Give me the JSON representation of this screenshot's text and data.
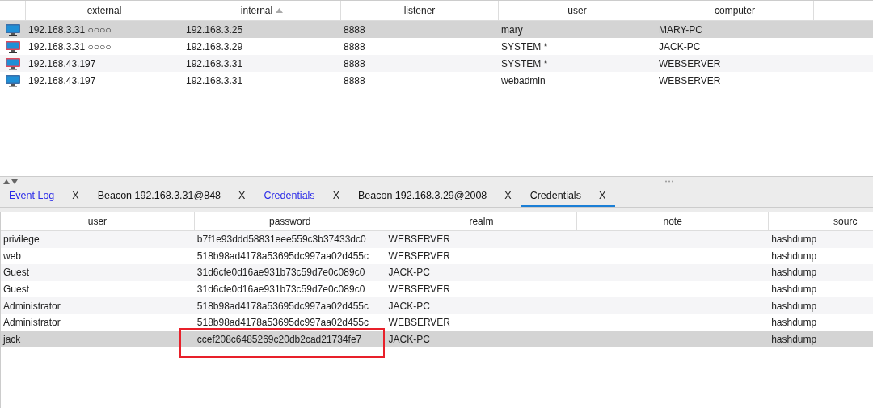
{
  "sessions": {
    "columns": [
      {
        "label": "external",
        "sorted": false
      },
      {
        "label": "internal",
        "sorted": true
      },
      {
        "label": "listener",
        "sorted": false
      },
      {
        "label": "user",
        "sorted": false
      },
      {
        "label": "computer",
        "sorted": false
      }
    ],
    "rows": [
      {
        "kind": "normal",
        "selected": true,
        "cells": [
          "192.168.3.31 ○○○○",
          "192.168.3.25",
          "8888",
          "mary",
          "MARY-PC"
        ]
      },
      {
        "kind": "elevated",
        "selected": false,
        "cells": [
          "192.168.3.31 ○○○○",
          "192.168.3.29",
          "8888",
          "SYSTEM *",
          "JACK-PC"
        ]
      },
      {
        "kind": "elevated",
        "selected": false,
        "cells": [
          "192.168.43.197",
          "192.168.3.31",
          "8888",
          "SYSTEM *",
          "WEBSERVER"
        ]
      },
      {
        "kind": "normal",
        "selected": false,
        "cells": [
          "192.168.43.197",
          "192.168.3.31",
          "8888",
          "webadmin",
          "WEBSERVER"
        ]
      }
    ]
  },
  "tabs": [
    {
      "label": "Event Log",
      "close": "X",
      "highlighted": true,
      "selected": false
    },
    {
      "label": "Beacon 192.168.3.31@848",
      "close": "X",
      "highlighted": false,
      "selected": false
    },
    {
      "label": "Credentials",
      "close": "X",
      "highlighted": true,
      "selected": false
    },
    {
      "label": "Beacon 192.168.3.29@2008",
      "close": "X",
      "highlighted": false,
      "selected": false
    },
    {
      "label": "Credentials",
      "close": "X",
      "highlighted": false,
      "selected": true
    }
  ],
  "credentials": {
    "columns": [
      "user",
      "password",
      "realm",
      "note",
      "sourc"
    ],
    "rows": [
      {
        "selected": false,
        "boxed": false,
        "cells": [
          "privilege",
          "b7f1e93ddd58831eee559c3b37433dc0",
          "WEBSERVER",
          "",
          "hashdump"
        ]
      },
      {
        "selected": false,
        "boxed": false,
        "cells": [
          "web",
          "518b98ad4178a53695dc997aa02d455c",
          "WEBSERVER",
          "",
          "hashdump"
        ]
      },
      {
        "selected": false,
        "boxed": false,
        "cells": [
          "Guest",
          "31d6cfe0d16ae931b73c59d7e0c089c0",
          "JACK-PC",
          "",
          "hashdump"
        ]
      },
      {
        "selected": false,
        "boxed": false,
        "cells": [
          "Guest",
          "31d6cfe0d16ae931b73c59d7e0c089c0",
          "WEBSERVER",
          "",
          "hashdump"
        ]
      },
      {
        "selected": false,
        "boxed": false,
        "cells": [
          "Administrator",
          "518b98ad4178a53695dc997aa02d455c",
          "JACK-PC",
          "",
          "hashdump"
        ]
      },
      {
        "selected": false,
        "boxed": false,
        "cells": [
          "Administrator",
          "518b98ad4178a53695dc997aa02d455c",
          "WEBSERVER",
          "",
          "hashdump"
        ]
      },
      {
        "selected": true,
        "boxed": true,
        "cells": [
          "jack",
          "ccef208c6485269c20db2cad21734fe7",
          "JACK-PC",
          "",
          "hashdump"
        ]
      }
    ]
  }
}
